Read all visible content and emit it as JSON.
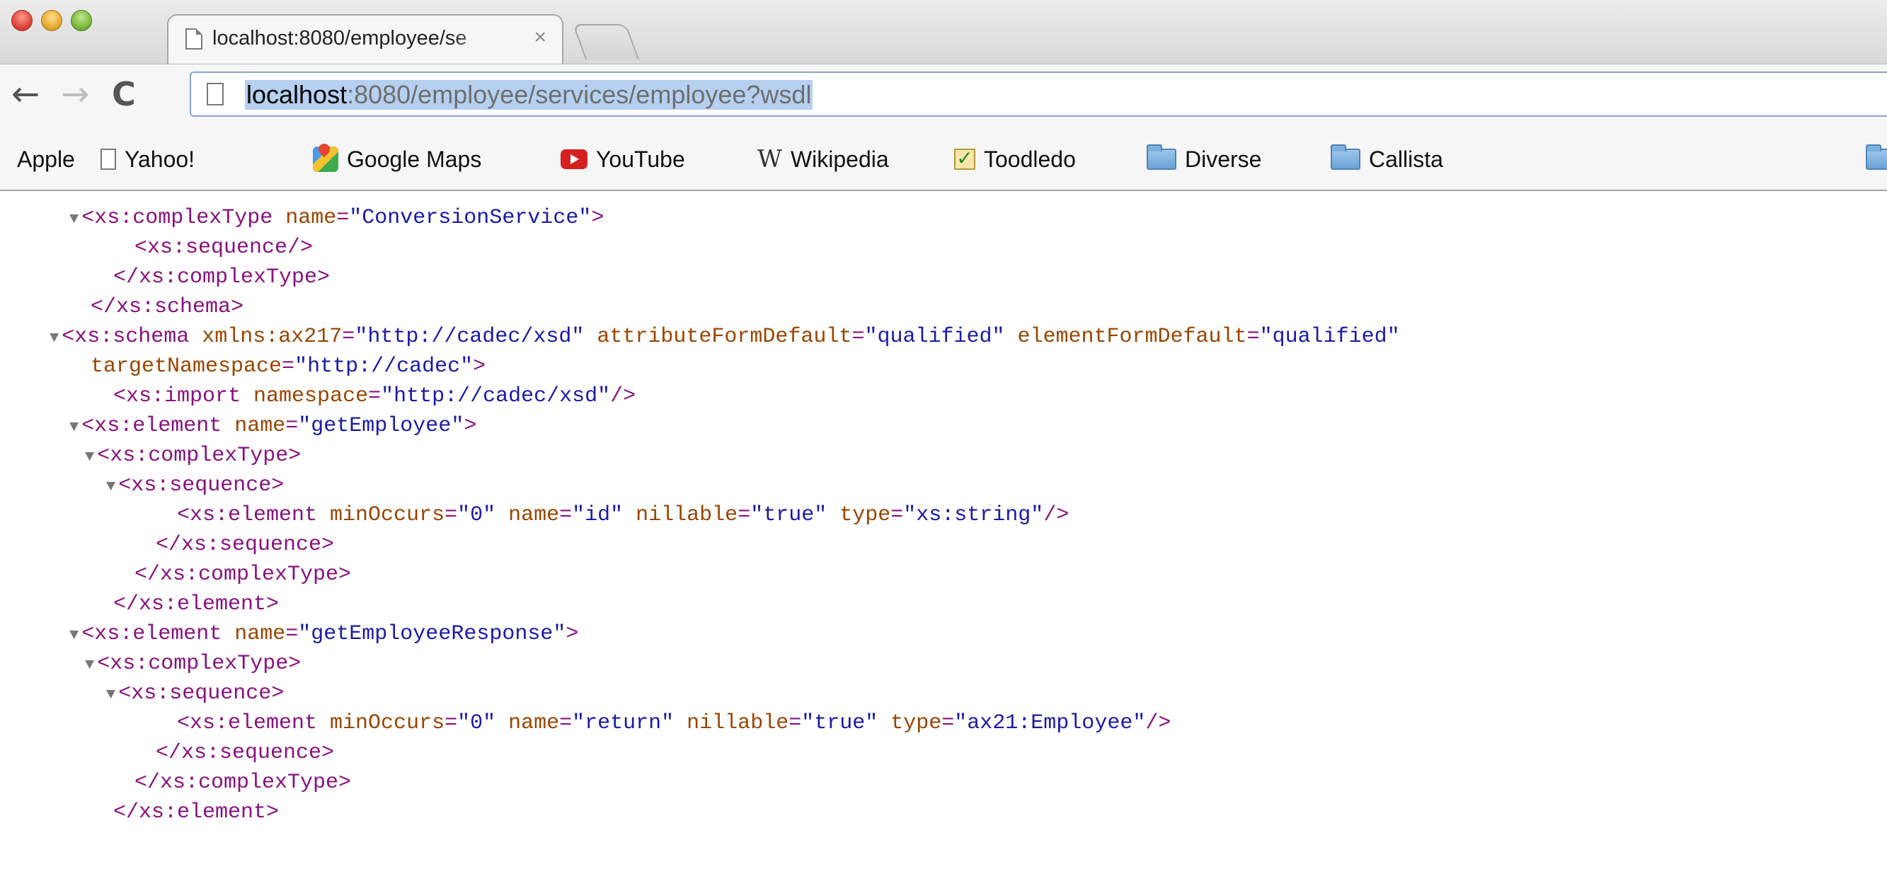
{
  "tab": {
    "title": "localhost:8080/employee/se",
    "close": "×"
  },
  "toolbar": {
    "back": "←",
    "forward": "→",
    "reload": "C",
    "url_host": "localhost",
    "url_rest": ":8080/employee/services/employee?wsdl"
  },
  "bookmarks": [
    {
      "label": "Apple",
      "icon": "apple-icon"
    },
    {
      "label": "Yahoo!",
      "icon": "page-icon"
    },
    {
      "label": "Google Maps",
      "icon": "google-maps-icon"
    },
    {
      "label": "YouTube",
      "icon": "youtube-icon"
    },
    {
      "label": "Wikipedia",
      "icon": "wikipedia-icon"
    },
    {
      "label": "Toodledo",
      "icon": "checkbox-icon"
    },
    {
      "label": "Diverse",
      "icon": "folder-icon"
    },
    {
      "label": "Callista",
      "icon": "folder-icon"
    }
  ],
  "xml": [
    {
      "tw": true,
      "p": [
        [
          "tg",
          "<xs:complexType "
        ],
        [
          "an",
          "name"
        ],
        [
          "pu",
          "="
        ],
        [
          "av",
          "\"ConversionService\""
        ],
        [
          "tg",
          ">"
        ]
      ]
    },
    {
      "tw": false,
      "p": [
        [
          "tg",
          "<xs:sequence/>"
        ]
      ]
    },
    {
      "tw": false,
      "p": [
        [
          "tg",
          "</xs:complexType>"
        ]
      ]
    },
    {
      "tw": false,
      "p": [
        [
          "tg",
          "</xs:schema>"
        ]
      ]
    },
    {
      "tw": true,
      "p": [
        [
          "tg",
          "<xs:schema "
        ],
        [
          "an",
          "xmlns:ax217"
        ],
        [
          "pu",
          "="
        ],
        [
          "av",
          "\"http://cadec/xsd\""
        ],
        [
          "an",
          " attributeFormDefault"
        ],
        [
          "pu",
          "="
        ],
        [
          "av",
          "\"qualified\""
        ],
        [
          "an",
          " elementFormDefault"
        ],
        [
          "pu",
          "="
        ],
        [
          "av",
          "\"qualified\""
        ]
      ]
    },
    {
      "tw": false,
      "p": [
        [
          "an",
          "targetNamespace"
        ],
        [
          "pu",
          "="
        ],
        [
          "av",
          "\"http://cadec\""
        ],
        [
          "tg",
          ">"
        ]
      ]
    },
    {
      "tw": false,
      "p": [
        [
          "tg",
          "<xs:import "
        ],
        [
          "an",
          "namespace"
        ],
        [
          "pu",
          "="
        ],
        [
          "av",
          "\"http://cadec/xsd\""
        ],
        [
          "tg",
          "/>"
        ]
      ]
    },
    {
      "tw": true,
      "p": [
        [
          "tg",
          "<xs:element "
        ],
        [
          "an",
          "name"
        ],
        [
          "pu",
          "="
        ],
        [
          "av",
          "\"getEmployee\""
        ],
        [
          "tg",
          ">"
        ]
      ]
    },
    {
      "tw": true,
      "p": [
        [
          "tg",
          "<xs:complexType>"
        ]
      ]
    },
    {
      "tw": true,
      "p": [
        [
          "tg",
          "<xs:sequence>"
        ]
      ]
    },
    {
      "tw": false,
      "p": [
        [
          "tg",
          "<xs:element "
        ],
        [
          "an",
          "minOccurs"
        ],
        [
          "pu",
          "="
        ],
        [
          "av",
          "\"0\""
        ],
        [
          "an",
          " name"
        ],
        [
          "pu",
          "="
        ],
        [
          "av",
          "\"id\""
        ],
        [
          "an",
          " nillable"
        ],
        [
          "pu",
          "="
        ],
        [
          "av",
          "\"true\""
        ],
        [
          "an",
          " type"
        ],
        [
          "pu",
          "="
        ],
        [
          "av",
          "\"xs:string\""
        ],
        [
          "tg",
          "/>"
        ]
      ]
    },
    {
      "tw": false,
      "p": [
        [
          "tg",
          "</xs:sequence>"
        ]
      ]
    },
    {
      "tw": false,
      "p": [
        [
          "tg",
          "</xs:complexType>"
        ]
      ]
    },
    {
      "tw": false,
      "p": [
        [
          "tg",
          "</xs:element>"
        ]
      ]
    },
    {
      "tw": true,
      "p": [
        [
          "tg",
          "<xs:element "
        ],
        [
          "an",
          "name"
        ],
        [
          "pu",
          "="
        ],
        [
          "av",
          "\"getEmployeeResponse\""
        ],
        [
          "tg",
          ">"
        ]
      ]
    },
    {
      "tw": true,
      "p": [
        [
          "tg",
          "<xs:complexType>"
        ]
      ]
    },
    {
      "tw": true,
      "p": [
        [
          "tg",
          "<xs:sequence>"
        ]
      ]
    },
    {
      "tw": false,
      "p": [
        [
          "tg",
          "<xs:element "
        ],
        [
          "an",
          "minOccurs"
        ],
        [
          "pu",
          "="
        ],
        [
          "av",
          "\"0\""
        ],
        [
          "an",
          " name"
        ],
        [
          "pu",
          "="
        ],
        [
          "av",
          "\"return\""
        ],
        [
          "an",
          " nillable"
        ],
        [
          "pu",
          "="
        ],
        [
          "av",
          "\"true\""
        ],
        [
          "an",
          " type"
        ],
        [
          "pu",
          "="
        ],
        [
          "av",
          "\"ax21:Employee\""
        ],
        [
          "tg",
          "/>"
        ]
      ]
    },
    {
      "tw": false,
      "p": [
        [
          "tg",
          "</xs:sequence>"
        ]
      ]
    },
    {
      "tw": false,
      "p": [
        [
          "tg",
          "</xs:complexType>"
        ]
      ]
    },
    {
      "tw": false,
      "p": [
        [
          "tg",
          "</xs:element>"
        ]
      ]
    }
  ]
}
